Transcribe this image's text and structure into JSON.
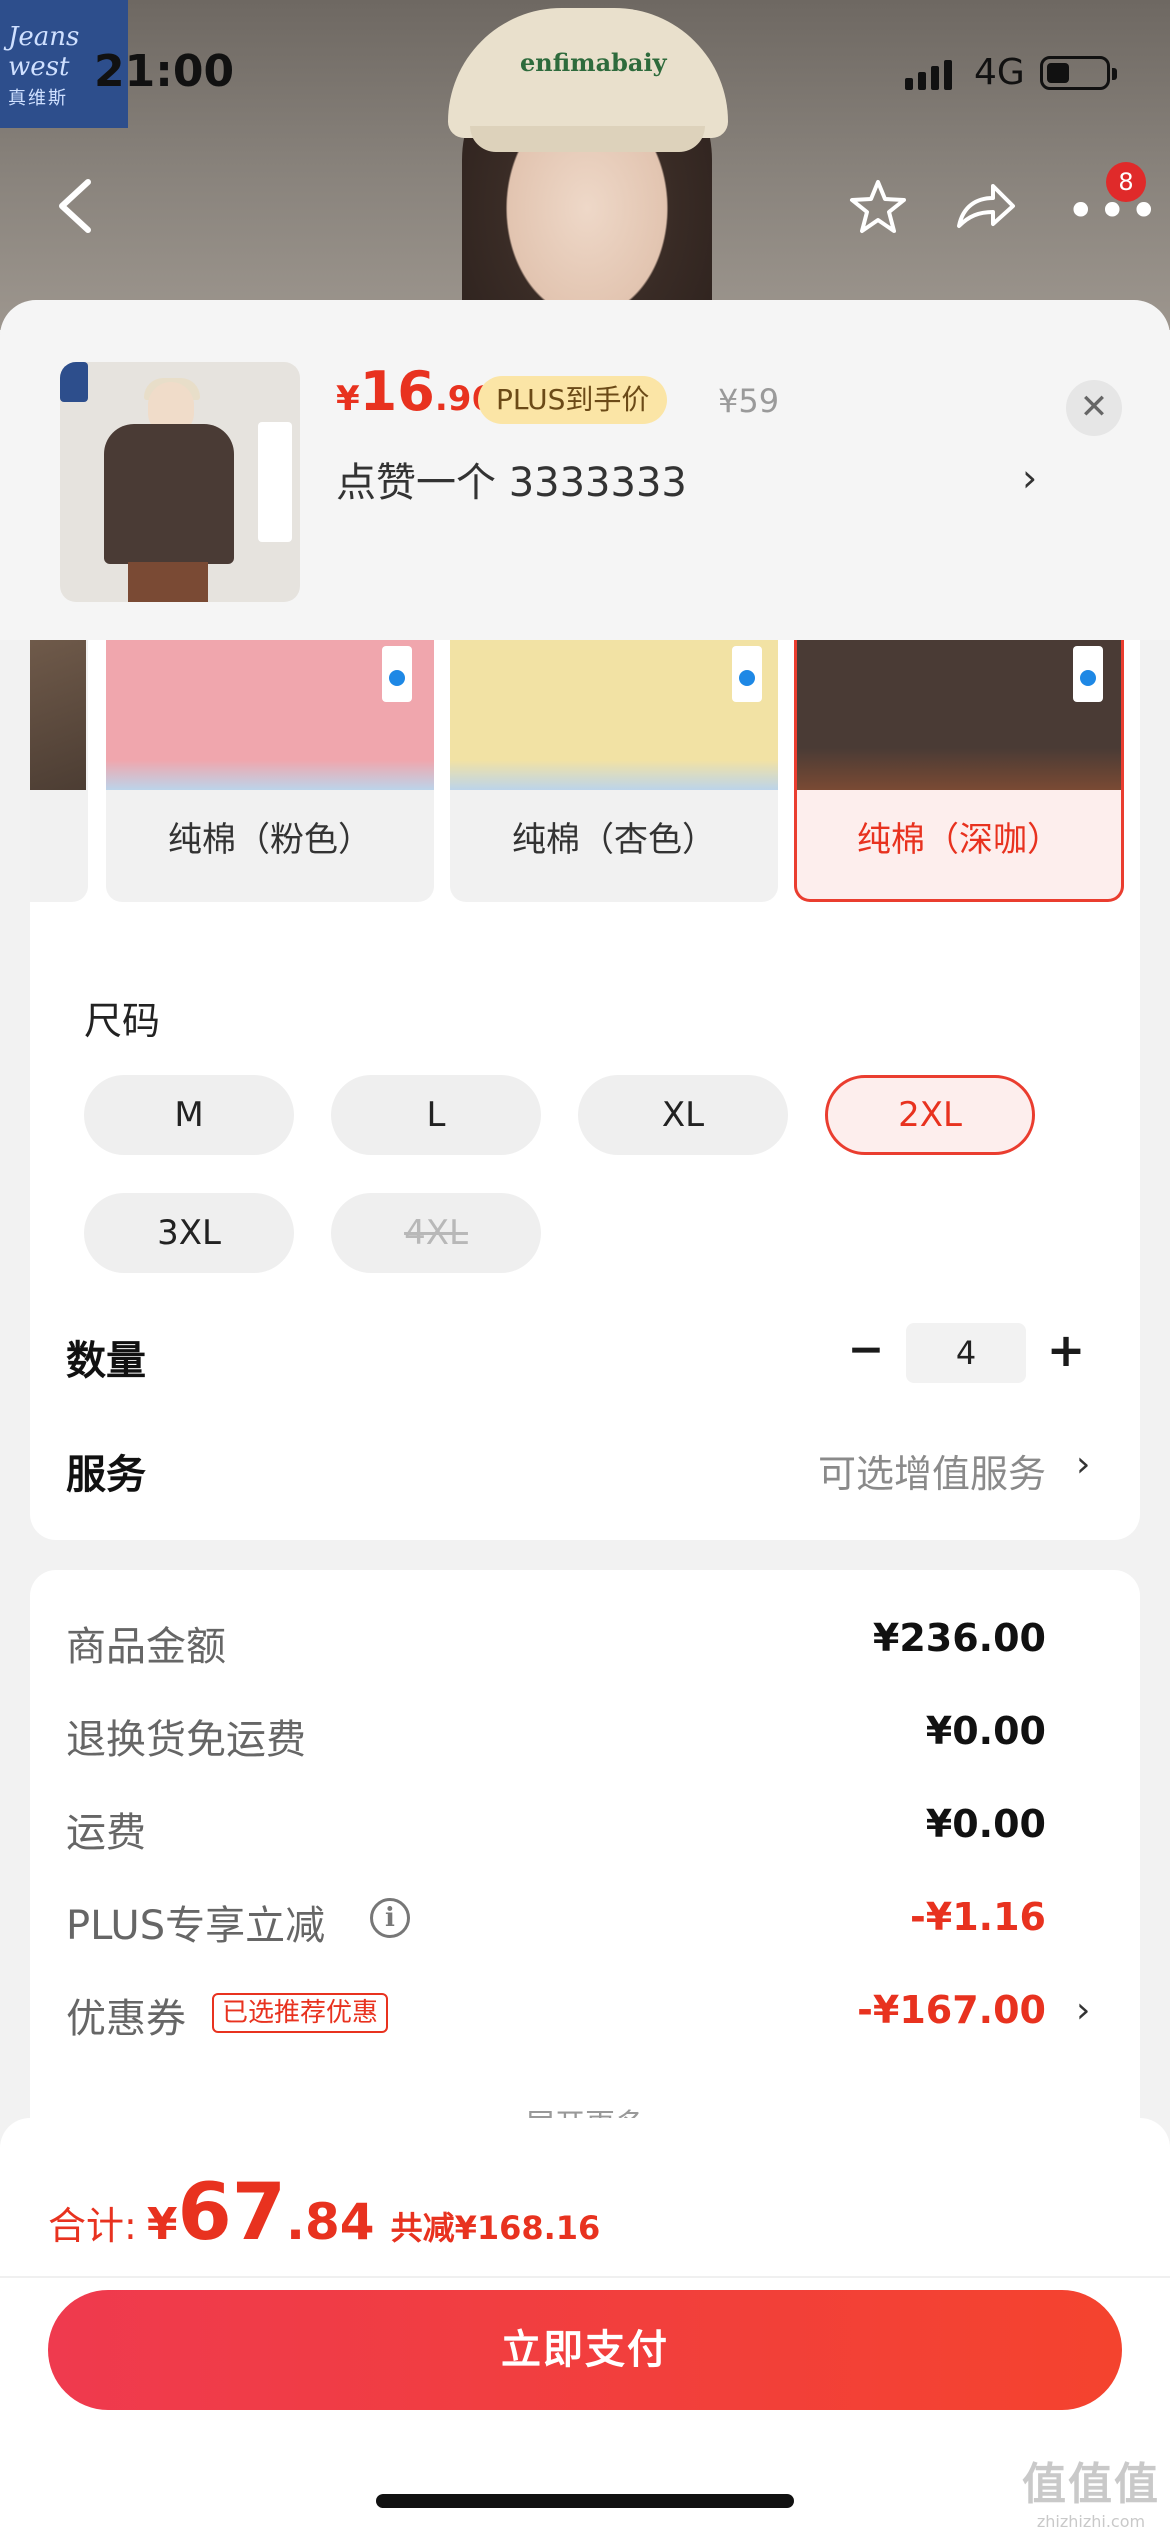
{
  "status_bar": {
    "time": "21:00",
    "network": "4G"
  },
  "brand_logo": {
    "line1": "Jeans",
    "line2": "west",
    "cn": "真维斯"
  },
  "hero": {
    "cap_text": "enfimabaiy"
  },
  "nav": {
    "cart_badge": "8"
  },
  "product": {
    "price_symbol": "¥",
    "price_int": "16",
    "price_dec": ".96",
    "plus_tag": "PLUS到手价",
    "original_price": "¥59",
    "subtitle": "点赞一个  3333333"
  },
  "colors": {
    "options": [
      {
        "label": "纯棉（粉色）",
        "swatch": "#f0a6ad",
        "selected": false
      },
      {
        "label": "纯棉（杏色）",
        "swatch": "#f2e2a4",
        "selected": false
      },
      {
        "label": "纯棉（深咖）",
        "swatch": "#4a3b35",
        "selected": true
      }
    ]
  },
  "size": {
    "label": "尺码",
    "options": [
      {
        "label": "M",
        "state": "normal"
      },
      {
        "label": "L",
        "state": "normal"
      },
      {
        "label": "XL",
        "state": "normal"
      },
      {
        "label": "2XL",
        "state": "selected"
      },
      {
        "label": "3XL",
        "state": "normal"
      },
      {
        "label": "4XL",
        "state": "disabled"
      }
    ]
  },
  "quantity": {
    "label": "数量",
    "value": "4",
    "minus": "−",
    "plus": "+"
  },
  "service": {
    "label": "服务",
    "value": "可选增值服务"
  },
  "summary": {
    "goods_label": "商品金额",
    "goods_value": "¥236.00",
    "return_label": "退换货免运费",
    "return_value": "¥0.00",
    "shipping_label": "运费",
    "shipping_value": "¥0.00",
    "plus_label": "PLUS专享立减",
    "plus_value": "-¥1.16",
    "coupon_label": "优惠券",
    "coupon_tag": "已选推荐优惠",
    "coupon_value": "-¥167.00",
    "expand_label": "展开更多"
  },
  "total": {
    "label": "合计:",
    "symbol": "¥",
    "int": "67",
    "dec": ".84",
    "save": "共减¥168.16"
  },
  "pay_button": "立即支付",
  "watermark": {
    "big": "值值值",
    "small": "zhizhizhi.com"
  },
  "accent_color": "#e8321f"
}
